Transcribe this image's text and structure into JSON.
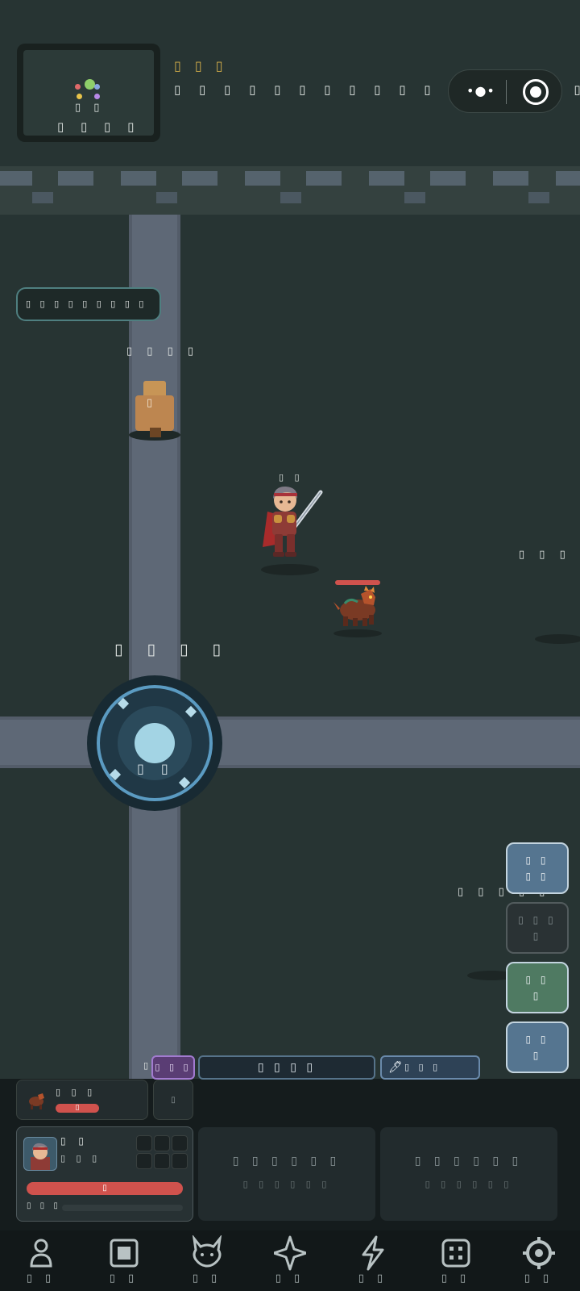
{
  "minimap": {
    "marker_label": "▯ ▯",
    "zone_name": "▯ ▯ ▯ ▯"
  },
  "quest": {
    "title": "▯ ▯ ▯",
    "text": "▯ ▯ ▯ ▯ ▯ ▯ ▯ ▯   ▯   ▯ ▯ ▯ ▯ ▯ ▯   ▯   ▯ ▯ ▯ ▯"
  },
  "capsule": {
    "menu_label": "•●•",
    "close_label": "▯"
  },
  "bubble": {
    "text": "▯ ▯  ▯ ▯ ▯ ▯  ▯   ▯ ▯"
  },
  "npc": {
    "name": "▯ ▯ ▯ ▯",
    "glyph": "▯"
  },
  "hero": {
    "name": "▯ ▯"
  },
  "world_labels": {
    "upper_right": "▯ ▯ ▯ ▯ ▯",
    "lower_right": "▯ ▯ ▯ ▯ ▯",
    "landmark": "▯ ▯ ▯ ▯"
  },
  "joystick": {
    "label": "▯ ▯"
  },
  "actions": [
    {
      "line1": "▯ ▯",
      "line2": "▯ ▯",
      "style": "blue"
    },
    {
      "line1": "▯ ▯ ▯",
      "line2": "▯",
      "style": "disabled"
    },
    {
      "line1": "▯ ▯",
      "line2": "▯",
      "style": "green"
    },
    {
      "line1": "▯ ▯",
      "line2": "▯",
      "style": "blue"
    }
  ],
  "tabs": {
    "left_prefix": "▯",
    "purple": "▯ ▯ ▯",
    "center": "▯ ▯ ▯   ▯",
    "right": "▯ ▯     ▯"
  },
  "pet": {
    "name": "▯ ▯ ▯",
    "hp_text": "▯",
    "side_label": "▯"
  },
  "hero_card": {
    "name": "▯ ▯",
    "level": "▯ ▯ ▯",
    "hp_text": "▯",
    "exp_label": "▯ ▯ ▯"
  },
  "empty_slots": [
    {
      "line1": "▯ ▯ ▯   ▯ ▯ ▯",
      "line2": "▯ ▯ ▯ ▯ ▯ ▯"
    },
    {
      "line1": "▯ ▯ ▯    ▯ ▯ ▯",
      "line2": "▯ ▯ ▯ ▯ ▯ ▯"
    }
  ],
  "nav": [
    {
      "icon": "person-icon",
      "label": "▯ ▯"
    },
    {
      "icon": "bag-icon",
      "label": "▯ ▯"
    },
    {
      "icon": "pet-icon",
      "label": "▯ ▯"
    },
    {
      "icon": "star-icon",
      "label": "▯ ▯"
    },
    {
      "icon": "lightning-icon",
      "label": "▯ ▯"
    },
    {
      "icon": "grid-icon",
      "label": "▯ ▯"
    },
    {
      "icon": "settings-icon",
      "label": "▯ ▯"
    }
  ],
  "colors": {
    "background": "#273433",
    "road": "#5e6876",
    "accent_gold": "#d7b04a",
    "hp_red": "#d0524d",
    "button_blue": "#557590",
    "button_green": "#4f7a62"
  }
}
